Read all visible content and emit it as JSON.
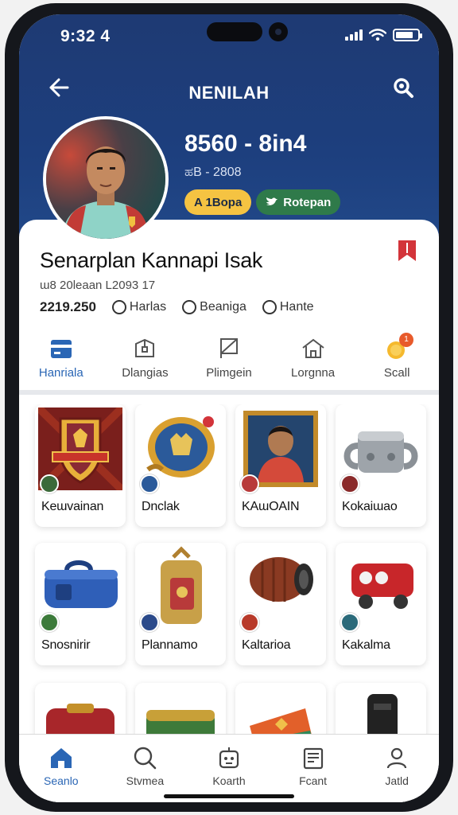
{
  "status": {
    "time": "9:32 4"
  },
  "header": {
    "title": "NENILAH"
  },
  "profile": {
    "number": "8560 - 8in4",
    "sub": "ಹB - 2808",
    "badges": [
      {
        "label": "A 1Bopa"
      },
      {
        "label": "Rotepan"
      }
    ]
  },
  "card": {
    "name": "Senarplan Kannapi Isak",
    "meta": "ɯ8 20leaan L2093 17",
    "count": "2219.250",
    "stats": [
      {
        "label": "Harlas"
      },
      {
        "label": "Beaniga"
      },
      {
        "label": "Hante"
      }
    ]
  },
  "categories": [
    {
      "label": "Hanriala",
      "icon": "card-icon"
    },
    {
      "label": "Dlangias",
      "icon": "box-icon"
    },
    {
      "label": "Plimgein",
      "icon": "flag-icon"
    },
    {
      "label": "Lorgnna",
      "icon": "home-icon"
    },
    {
      "label": "Scall",
      "icon": "coin-icon",
      "badge": "1"
    }
  ],
  "items": [
    {
      "label": "Keɯvainan",
      "icon": "crest-shield-icon"
    },
    {
      "label": "Dnclak",
      "icon": "gold-medallion-icon"
    },
    {
      "label": "KAɯOAIN",
      "icon": "player-card-icon"
    },
    {
      "label": "Kokaiɯao",
      "icon": "silver-mug-icon"
    },
    {
      "label": "Snosnirir",
      "icon": "blue-bag-icon"
    },
    {
      "label": "Plannamo",
      "icon": "gold-backpack-icon"
    },
    {
      "label": "Kaltarioa",
      "icon": "brown-barrel-icon"
    },
    {
      "label": "Kakalma",
      "icon": "red-cart-icon"
    },
    {
      "label": "",
      "icon": "red-case-icon"
    },
    {
      "label": "",
      "icon": "green-case-icon"
    },
    {
      "label": "",
      "icon": "orange-pouch-icon"
    },
    {
      "label": "",
      "icon": "black-holster-icon"
    }
  ],
  "bottom_nav": [
    {
      "label": "Seanlo",
      "icon": "home-icon"
    },
    {
      "label": "Stvmea",
      "icon": "search-icon"
    },
    {
      "label": "Koarth",
      "icon": "robot-icon"
    },
    {
      "label": "Fcant",
      "icon": "document-icon"
    },
    {
      "label": "Jatld",
      "icon": "person-icon"
    }
  ],
  "colors": {
    "header": "#1e3a73",
    "accent": "#2a66b5",
    "badge_yellow": "#f5c342",
    "badge_green": "#2f7a4a",
    "bookmark": "#d3343a"
  }
}
